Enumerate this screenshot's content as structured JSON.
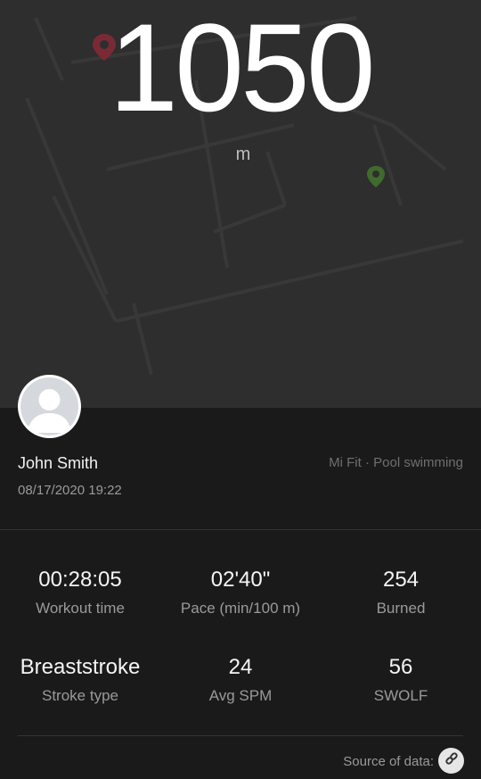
{
  "workout": {
    "distance": "1050",
    "distance_unit": "m"
  },
  "user": {
    "name": "John Smith",
    "date": "08/17/2020 19:22",
    "source_app": "Mi Fit · Pool swimming"
  },
  "stats": [
    {
      "value": "00:28:05",
      "label": "Workout time"
    },
    {
      "value": "02'40\"",
      "label": "Pace (min/100 m)"
    },
    {
      "value": "254",
      "label": "Burned"
    },
    {
      "value": "Breaststroke",
      "label": "Stroke type"
    },
    {
      "value": "24",
      "label": "Avg SPM"
    },
    {
      "value": "56",
      "label": "SWOLF"
    }
  ],
  "footer": {
    "source_label": "Source of data:"
  },
  "colors": {
    "map_bg": "#2e2e2e",
    "panel_bg": "#1a1a1a",
    "start_pin": "#7a2a35",
    "end_pin": "#3f6b2d"
  },
  "icons": {
    "start": "map-pin-start-icon",
    "end": "map-pin-end-icon",
    "avatar": "user-avatar-icon",
    "source": "link-icon"
  }
}
